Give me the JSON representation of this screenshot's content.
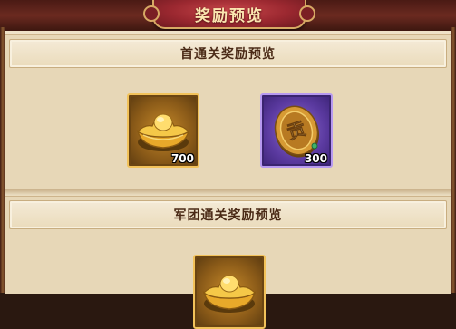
{
  "title": "奖励预览",
  "sections": [
    {
      "header": "首通关奖励预览",
      "items": [
        {
          "icon": "gold-ingot-icon",
          "qty": "700",
          "rarity": "gold"
        },
        {
          "icon": "contribution-medal-icon",
          "qty": "300",
          "rarity": "purple",
          "glyph": "贡"
        }
      ]
    },
    {
      "header": "军团通关奖励预览",
      "items": [
        {
          "icon": "gold-ingot-icon",
          "rarity": "gold"
        }
      ]
    }
  ],
  "colors": {
    "title_plate": "#9b2830",
    "title_text": "#fbe6b0",
    "panel_bg": "#efe2c8",
    "header_text": "#4a2a16",
    "gold_border": "#f2c25a",
    "purple_border": "#b799f0"
  }
}
